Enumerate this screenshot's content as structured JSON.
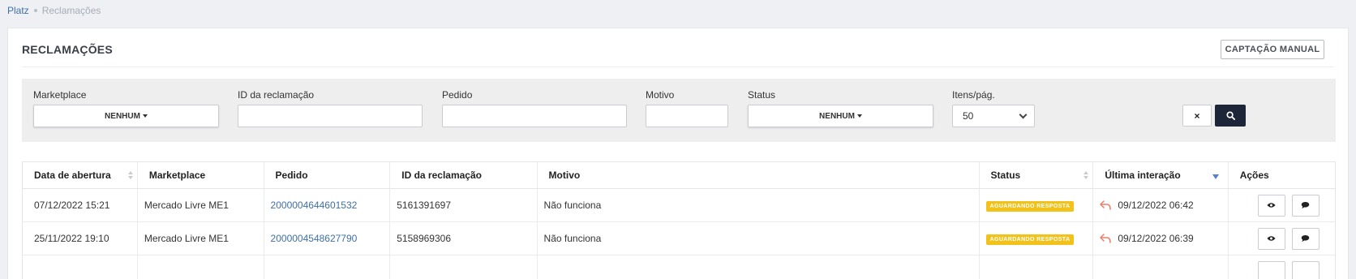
{
  "breadcrumb": {
    "home": "Platz",
    "current": "Reclamações"
  },
  "panel": {
    "title": "RECLAMAÇÕES",
    "manual_button": "CAPTAÇÃO MANUAL"
  },
  "filters": {
    "marketplace": {
      "label": "Marketplace",
      "value": "NENHUM"
    },
    "claim_id": {
      "label": "ID da reclamação",
      "value": ""
    },
    "order": {
      "label": "Pedido",
      "value": ""
    },
    "reason": {
      "label": "Motivo",
      "value": ""
    },
    "status": {
      "label": "Status",
      "value": "NENHUM"
    },
    "per_page": {
      "label": "Itens/pág.",
      "value": "50"
    },
    "clear_label": "×"
  },
  "table": {
    "columns": [
      "Data de abertura",
      "Marketplace",
      "Pedido",
      "ID da reclamação",
      "Motivo",
      "Status",
      "Última interação",
      "Ações"
    ],
    "rows": [
      {
        "opened": "07/12/2022 15:21",
        "marketplace": "Mercado Livre ME1",
        "order": "2000004644601532",
        "claim_id": "5161391697",
        "reason": "Não funciona",
        "status": "AGUARDANDO RESPOSTA",
        "last_interaction": "09/12/2022 06:42"
      },
      {
        "opened": "25/11/2022 19:10",
        "marketplace": "Mercado Livre ME1",
        "order": "2000004548627790",
        "claim_id": "5158969306",
        "reason": "Não funciona",
        "status": "AGUARDANDO RESPOSTA",
        "last_interaction": "09/12/2022 06:39"
      },
      {
        "opened": "",
        "marketplace": "",
        "order": "",
        "claim_id": "",
        "reason": "",
        "status": "",
        "last_interaction": ""
      }
    ]
  },
  "colors": {
    "accent_dark": "#1d2539",
    "badge_yellow": "#f2c21b",
    "link_blue": "#3f6fa8",
    "reply_icon": "#e8806a"
  },
  "icons": {
    "search": "search-icon",
    "view": "eye-icon",
    "comment": "comment-icon",
    "reply": "reply-icon"
  }
}
